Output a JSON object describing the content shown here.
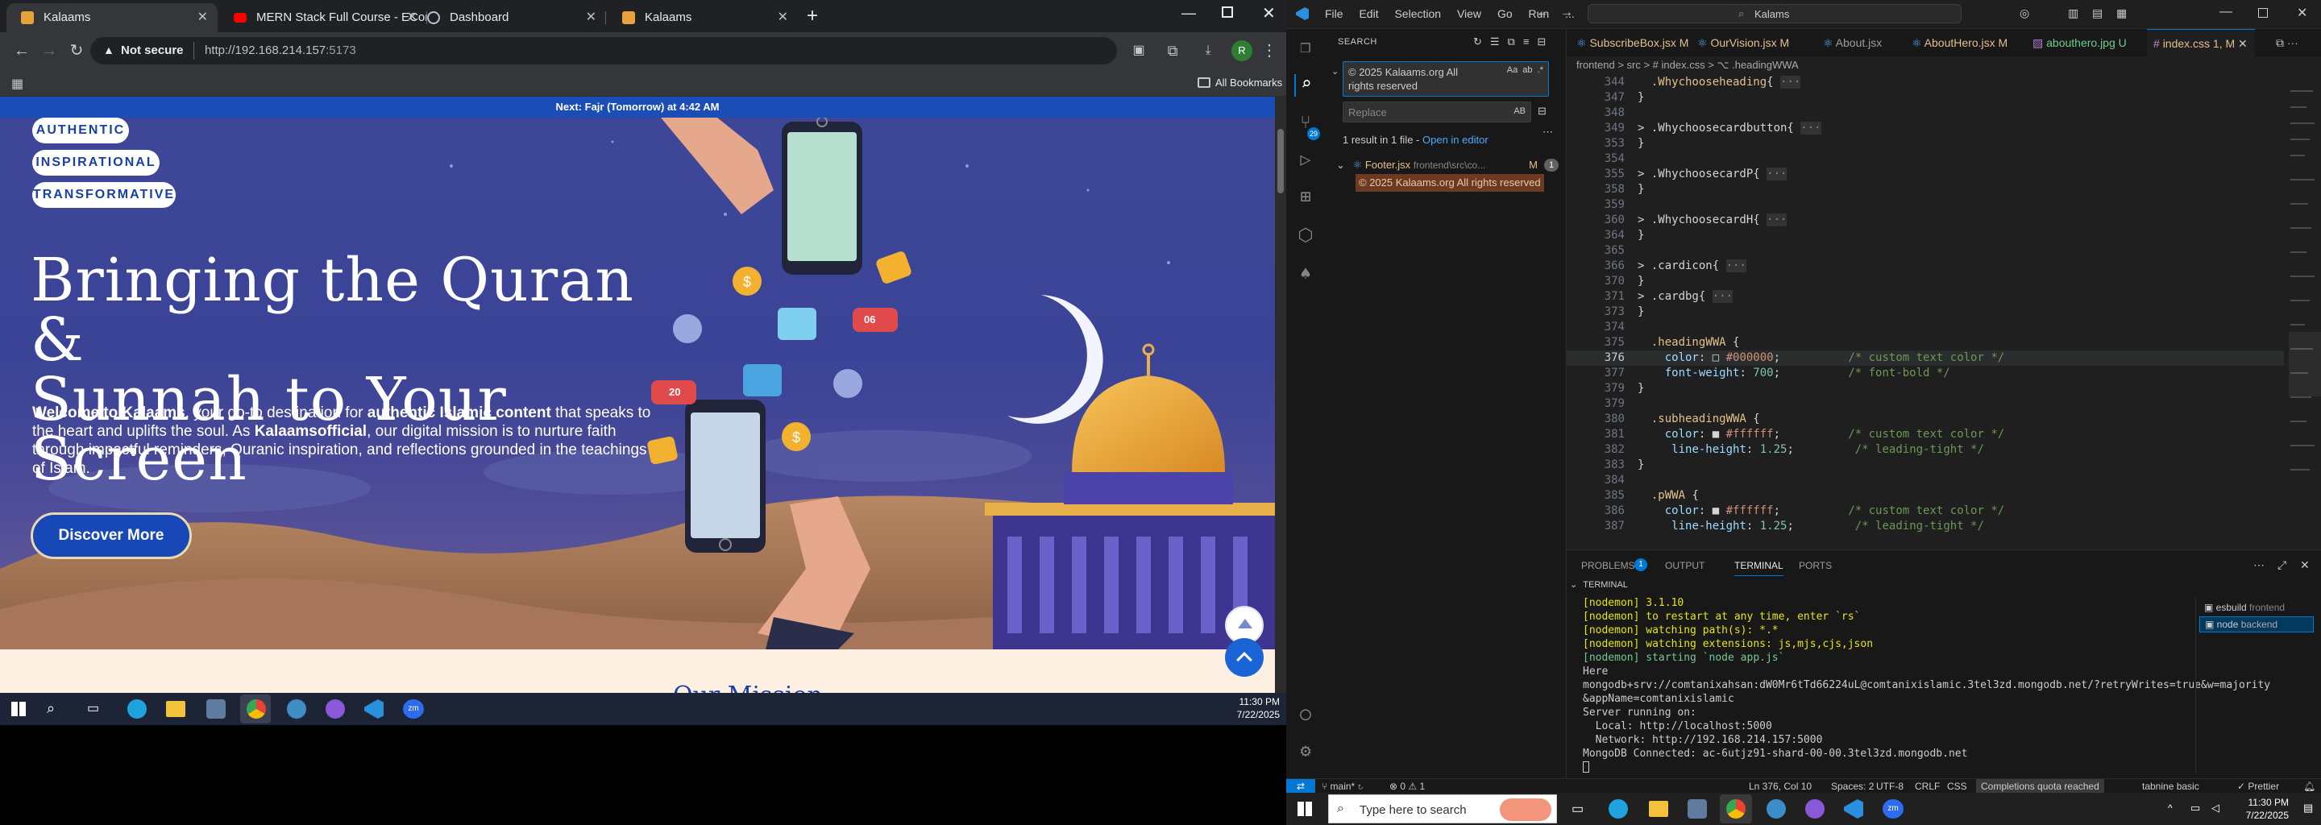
{
  "chrome": {
    "tabs": [
      {
        "title": "Kalaams",
        "active": true
      },
      {
        "title": "MERN Stack Full Course - ECom",
        "active": false
      },
      {
        "title": "Dashboard",
        "active": false
      },
      {
        "title": "Kalaams",
        "active": false
      }
    ],
    "security_label": "Not secure",
    "url_host": "http://192.168.214.157",
    "url_port": ":5173",
    "bookmarks_label": "All Bookmarks",
    "profile_initial": "R"
  },
  "site": {
    "prayer_prefix": "Next: ",
    "prayer_name": "Fajr (Tomorrow)",
    "prayer_suffix": " at 4:42 AM",
    "pills": [
      "AUTHENTIC",
      "INSPIRATIONAL",
      "TRANSFORMATIVE"
    ],
    "headline_line1": "Bringing the Quran &",
    "headline_line2": "Sunnah to Your Screen",
    "intro_a": "Welcome to Kalaams",
    "intro_b": ", your go-to destination for ",
    "intro_c": "authentic Islamic content",
    "intro_d": " that speaks to the heart and uplifts the soul. As ",
    "intro_e": "Kalaamsofficial",
    "intro_f": ", our digital mission is to nurture faith through impactful reminders, Quranic inspiration, and reflections grounded in the teachings of Islam.",
    "cta": "Discover More",
    "badge_heart": "20",
    "badge_people": "06",
    "mission_title": "Our Mission"
  },
  "left_taskbar": {
    "time": "11:30 PM",
    "date": "7/22/2025"
  },
  "vscode": {
    "menu": [
      "File",
      "Edit",
      "Selection",
      "View",
      "Go",
      "Run",
      "..."
    ],
    "search_box": "Kalams",
    "sidebar_title": "SEARCH",
    "search_query": "© 2025 Kalaams.org All rights reserved",
    "replace_placeholder": "Replace",
    "replace_all": "AB",
    "result_summary": "1 result in 1 file - ",
    "open_in_editor": "Open in editor",
    "result_file": "Footer.jsx",
    "result_path": "frontend\\src\\co...",
    "result_badge": "M",
    "result_count": "1",
    "result_match": "© 2025 Kalaams.org All rights reserved",
    "editor_tabs": [
      {
        "name": "SubscribeBox.jsx",
        "mod": "M"
      },
      {
        "name": "OurVision.jsx",
        "mod": "M"
      },
      {
        "name": "About.jsx",
        "mod": ""
      },
      {
        "name": "AboutHero.jsx",
        "mod": "M"
      },
      {
        "name": "abouthero.jpg",
        "mod": "U"
      },
      {
        "name": "index.css",
        "mod": "1, M"
      }
    ],
    "breadcrumb": "frontend  >  src  >  # index.css  >  ⌥ .headingWWA",
    "code_lines": [
      {
        "n": "344",
        "t": "  .Whychooseheading{ ···"
      },
      {
        "n": "347",
        "t": "}"
      },
      {
        "n": "348",
        "t": ""
      },
      {
        "n": "349",
        "t": "> .Whychoosecardbutton{ ···"
      },
      {
        "n": "353",
        "t": "}"
      },
      {
        "n": "354",
        "t": ""
      },
      {
        "n": "355",
        "t": "> .WhychoosecardP{ ···"
      },
      {
        "n": "358",
        "t": "}"
      },
      {
        "n": "359",
        "t": ""
      },
      {
        "n": "360",
        "t": "> .WhychoosecardH{ ···"
      },
      {
        "n": "364",
        "t": "}"
      },
      {
        "n": "365",
        "t": ""
      },
      {
        "n": "366",
        "t": "> .cardicon{ ···"
      },
      {
        "n": "370",
        "t": "}"
      },
      {
        "n": "371",
        "t": "> .cardbg{ ···"
      },
      {
        "n": "373",
        "t": "}"
      },
      {
        "n": "374",
        "t": ""
      },
      {
        "n": "375",
        "t": "  .headingWWA {"
      },
      {
        "n": "376",
        "t": "    color: □ #000000;          /* custom text color */"
      },
      {
        "n": "377",
        "t": "    font-weight: 700;          /* font-bold */"
      },
      {
        "n": "379",
        "t": "}"
      },
      {
        "n": "379",
        "t": ""
      },
      {
        "n": "380",
        "t": "  .subheadingWWA {"
      },
      {
        "n": "381",
        "t": "    color: ■ #ffffff;          /* custom text color */"
      },
      {
        "n": "382",
        "t": "     line-height: 1.25;         /* leading-tight */"
      },
      {
        "n": "383",
        "t": "}"
      },
      {
        "n": "384",
        "t": ""
      },
      {
        "n": "385",
        "t": "  .pWWA {"
      },
      {
        "n": "386",
        "t": "    color: ■ #ffffff;          /* custom text color */"
      },
      {
        "n": "387",
        "t": "     line-height: 1.25;         /* leading-tight */"
      }
    ],
    "panel_tabs": [
      "PROBLEMS",
      "OUTPUT",
      "TERMINAL",
      "PORTS"
    ],
    "problems_count": "1",
    "terminal_header": "TERMINAL",
    "terminal_lines": [
      "[nodemon] 3.1.10",
      "[nodemon] to restart at any time, enter `rs`",
      "[nodemon] watching path(s): *.*",
      "[nodemon] watching extensions: js,mjs,cjs,json",
      "[nodemon] starting `node app.js`",
      "Here",
      "mongodb+srv://comtanixahsan:dW0Mr6tTd66224uL@comtanixislamic.3tel3zd.mongodb.net/?retryWrites=true&w=majority",
      "&appName=comtanixislamic",
      "Server running on:",
      "  Local: http://localhost:5000",
      "  Network: http://192.168.214.157:5000",
      "MongoDB Connected: ac-6utjz91-shard-00-00.3tel3zd.mongodb.net"
    ],
    "terminal_procs": [
      {
        "name": "esbuild",
        "sub": "frontend"
      },
      {
        "name": "node",
        "sub": "backend"
      }
    ],
    "status": {
      "branch": "main*",
      "errors": "⊗ 0 ⚠ 1",
      "position": "Ln 376, Col 10",
      "spaces": "Spaces: 2",
      "encoding": "UTF-8",
      "eol": "CRLF",
      "lang": "CSS",
      "quota": "Completions quota reached",
      "tabnine": "tabnine basic",
      "prettier": "✓ Prettier"
    }
  },
  "win_taskbar": {
    "search_placeholder": "Type here to search",
    "time": "11:30 PM",
    "date": "7/22/2025"
  },
  "colors": {
    "hero_bg": "#3e4797",
    "brand_blue": "#1a3fa6",
    "vscode_accent": "#0078d4"
  }
}
